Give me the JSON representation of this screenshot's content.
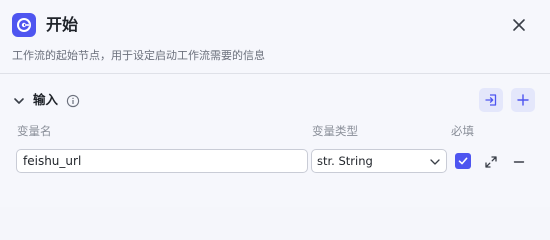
{
  "header": {
    "title": "开始",
    "description": "工作流的起始节点，用于设定启动工作流需要的信息",
    "icon": "start-node-icon",
    "accent": "#4e55f0"
  },
  "input_section": {
    "title": "输入",
    "columns": {
      "name": "变量名",
      "type": "变量类型",
      "required": "必填"
    },
    "rows": [
      {
        "name": "feishu_url",
        "type": "str. String",
        "required": true
      }
    ]
  }
}
